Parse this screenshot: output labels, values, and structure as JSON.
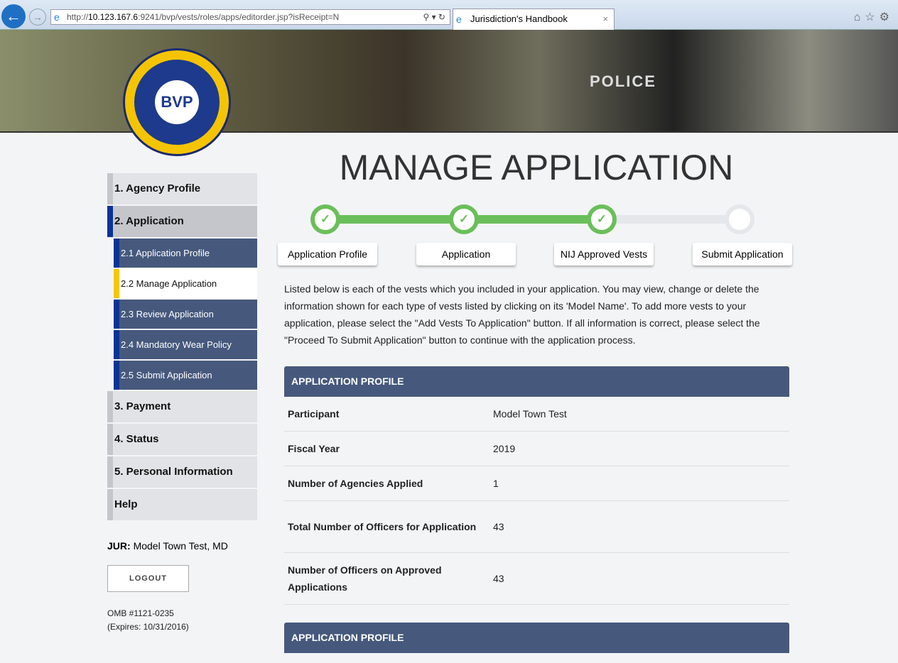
{
  "browser": {
    "url_prefix": "http://",
    "url_host": "10.123.167.6",
    "url_rest": ":9241/bvp/vests/roles/apps/editorder.jsp?isReceipt=N",
    "tab_title": "Jurisdiction's Handbook"
  },
  "banner": {
    "police_text": "POLICE",
    "logo_text": "BULLETPROOF VEST PARTNERSHIP"
  },
  "sidebar": {
    "items": [
      "1. Agency Profile",
      "2. Application",
      "3. Payment",
      "4. Status",
      "5. Personal Information",
      "Help"
    ],
    "sub": [
      "2.1 Application Profile",
      "2.2 Manage Application",
      "2.3 Review Application",
      "2.4 Mandatory Wear Policy",
      "2.5 Submit Application"
    ],
    "jur_label": "JUR:",
    "jur_value": "Model Town Test, MD",
    "logout": "LOGOUT",
    "omb": "OMB #1121-0235",
    "expires": "(Expires: 10/31/2016)"
  },
  "main": {
    "title": "MANAGE APPLICATION",
    "progress_completed": 3,
    "progress_total": 4,
    "steps": [
      "Application Profile",
      "Application",
      "NIJ Approved Vests",
      "Submit Application"
    ],
    "intro": "Listed below is each of the vests which you included in your application.  You may view, change or delete the information shown for each type of vests listed by clicking on its 'Model Name'. To add more vests to your application, please select the \"Add Vests To Application\" button. If all information is correct, please select the \"Proceed To Submit Application\" button to continue with the application process.",
    "table_header": "APPLICATION PROFILE",
    "rows": [
      {
        "k": "Participant",
        "v": "Model Town Test"
      },
      {
        "k": "Fiscal Year",
        "v": "2019"
      },
      {
        "k": "Number of Agencies Applied",
        "v": "1"
      },
      {
        "k": "Total Number of Officers for Application",
        "v": "43"
      },
      {
        "k": "Number of Officers on Approved Applications",
        "v": "43"
      }
    ],
    "table2_header": "APPLICATION PROFILE"
  }
}
